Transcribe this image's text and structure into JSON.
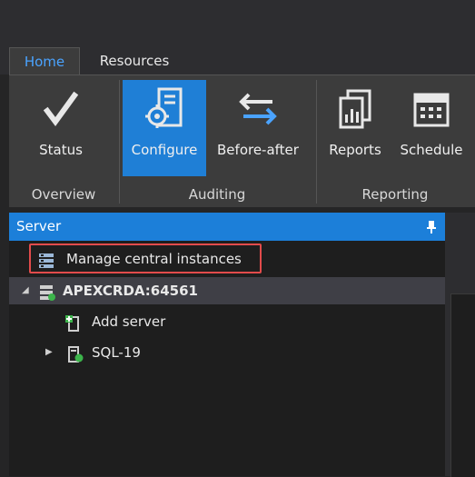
{
  "tabs": [
    {
      "label": "Home",
      "active": true
    },
    {
      "label": "Resources",
      "active": false
    }
  ],
  "ribbon": {
    "buttons": [
      {
        "label": "Status",
        "icon": "checkmark-icon"
      },
      {
        "label": "Configure",
        "icon": "configure-gear-icon",
        "selected": true
      },
      {
        "label": "Before-after",
        "icon": "swap-arrows-icon"
      },
      {
        "label": "Reports",
        "icon": "reports-icon"
      },
      {
        "label": "Schedule",
        "icon": "calendar-icon"
      }
    ],
    "groups": [
      {
        "label": "Overview"
      },
      {
        "label": "Auditing"
      },
      {
        "label": "Reporting"
      }
    ]
  },
  "panel": {
    "title": "Server",
    "pin_icon": "pin-icon"
  },
  "tree": {
    "manage": "Manage central instances",
    "root": "APEXCRDA:64561",
    "add_server": "Add server",
    "server": "SQL-19"
  },
  "colors": {
    "accent": "#1f7fd6",
    "highlight": "#e24b4b",
    "active_tab_text": "#4aa3ff"
  }
}
